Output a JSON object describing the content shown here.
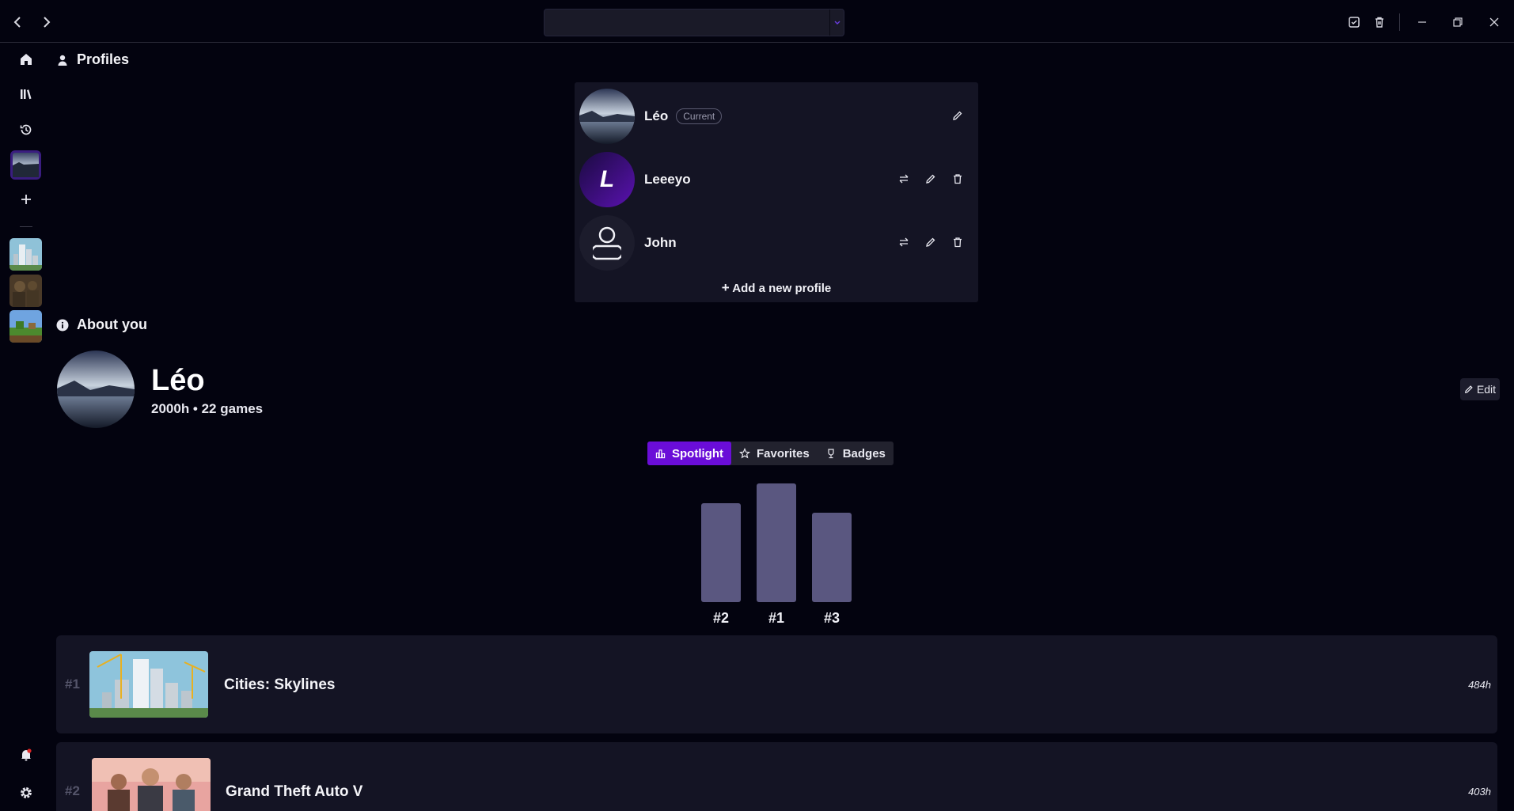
{
  "titlebar": {
    "search_value": ""
  },
  "profiles": {
    "title": "Profiles",
    "items": [
      {
        "name": "Léo",
        "badge": "Current"
      },
      {
        "name": "Leeeyo",
        "initial": "L"
      },
      {
        "name": "John"
      }
    ],
    "add_label": "Add a new profile"
  },
  "about": {
    "title": "About you",
    "name": "Léo",
    "stats": "2000h • 22 games",
    "edit_label": "Edit"
  },
  "tabs": [
    {
      "label": "Spotlight",
      "icon": "chart-icon",
      "active": true
    },
    {
      "label": "Favorites",
      "icon": "star-icon"
    },
    {
      "label": "Badges",
      "icon": "trophy-icon"
    }
  ],
  "podium": {
    "labels": [
      "#2",
      "#1",
      "#3"
    ]
  },
  "games": [
    {
      "rank": "#1",
      "title": "Cities: Skylines",
      "hours": "484h"
    },
    {
      "rank": "#2",
      "title": "Grand Theft Auto V",
      "hours": "403h"
    }
  ],
  "colors": {
    "accent": "#6a0dd8",
    "background": "#03030f",
    "card": "#141424"
  }
}
